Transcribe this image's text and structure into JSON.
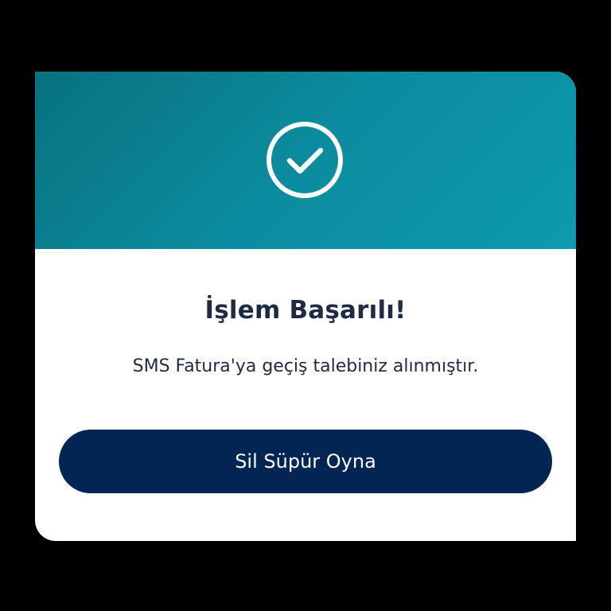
{
  "dialog": {
    "status_icon": "check-circle-icon",
    "title": "İşlem Başarılı!",
    "message": "SMS Fatura'ya geçiş talebiniz alınmıştır.",
    "primary_button_label": "Sil Süpür Oyna"
  },
  "colors": {
    "backdrop": "#000000",
    "header_gradient_start": "#08717f",
    "header_gradient_end": "#0e9ab0",
    "button": "#032554",
    "text": "#1f2a44"
  }
}
